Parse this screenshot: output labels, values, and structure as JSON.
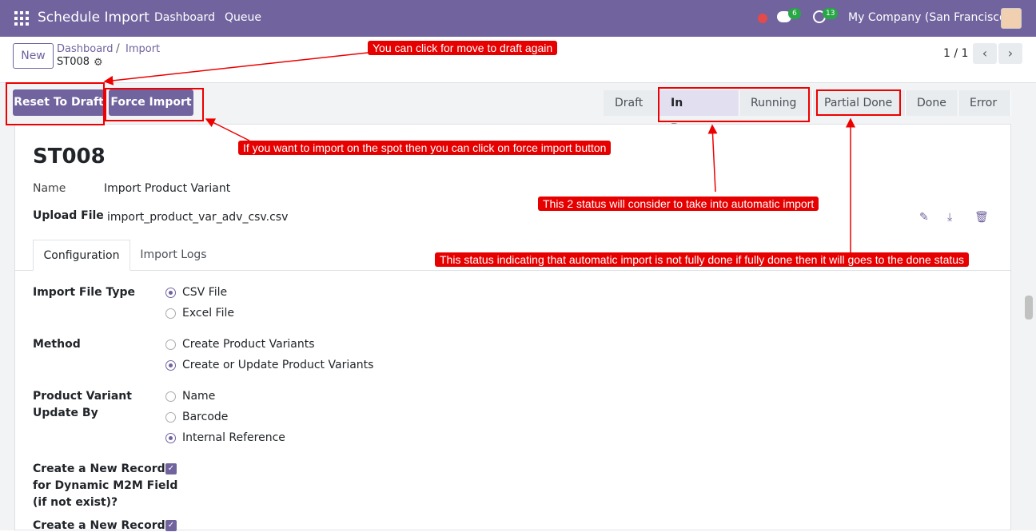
{
  "topbar": {
    "app_title": "Schedule Import",
    "nav": [
      "Dashboard",
      "Queue"
    ],
    "chat_count": "6",
    "activity_count": "13",
    "company": "My Company (San Francisco)"
  },
  "controlpanel": {
    "new_label": "New",
    "breadcrumb_parent": "Dashboard",
    "breadcrumb_sep": "/",
    "breadcrumb_current": "Import",
    "record_name": "ST008",
    "pager": "1 / 1"
  },
  "actions": {
    "reset_label": "Reset To Draft",
    "force_label": "Force Import"
  },
  "status": [
    "Draft",
    "In Progress",
    "Running",
    "Partial Done",
    "Done",
    "Error"
  ],
  "status_active": "In Progress",
  "form": {
    "title": "ST008",
    "name_label": "Name",
    "name_value": "Import Product Variant",
    "upload_label": "Upload File",
    "upload_value": "import_product_var_adv_csv.csv",
    "tabs": [
      "Configuration",
      "Import Logs"
    ],
    "file_type_label": "Import File Type",
    "file_types": [
      "CSV File",
      "Excel File"
    ],
    "method_label": "Method",
    "methods": [
      "Create Product Variants",
      "Create or Update Product Variants"
    ],
    "update_by_label_1": "Product Variant",
    "update_by_label_2": "Update By",
    "update_by": [
      "Name",
      "Barcode",
      "Internal Reference"
    ],
    "m2m_label_1": "Create a New Record",
    "m2m_label_2": "for Dynamic M2M Field",
    "m2m_label_3": "(if not exist)?",
    "m2m_label_next": "Create a New Record"
  },
  "callouts": {
    "draft": "You can click for move to draft again",
    "force": "If you want to import on the spot then you can click on force import button",
    "auto": "This 2 status will consider to take into automatic import",
    "partial": "This status indicating that automatic import is not fully done if fully done then it will goes to the done status"
  }
}
